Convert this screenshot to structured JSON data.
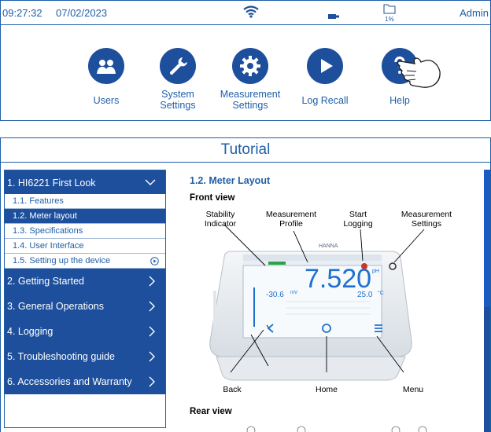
{
  "statusbar": {
    "time": "09:27:32",
    "date": "07/02/2023",
    "storage_percent": "1%",
    "user": "Admin"
  },
  "home_menu": [
    {
      "id": "users",
      "label": "Users",
      "icon": "users-icon"
    },
    {
      "id": "system-settings",
      "label": "System Settings",
      "icon": "wrench-icon"
    },
    {
      "id": "measurement-settings",
      "label": "Measurement Settings",
      "icon": "gear-icon"
    },
    {
      "id": "log-recall",
      "label": "Log Recall",
      "icon": "play-icon"
    },
    {
      "id": "help",
      "label": "Help",
      "icon": "question-icon"
    }
  ],
  "tutorial": {
    "title": "Tutorial",
    "sections": [
      {
        "label": "1. HI6221 First Look",
        "expanded": true
      },
      {
        "label": "2. Getting Started"
      },
      {
        "label": "3. General Operations"
      },
      {
        "label": "4. Logging"
      },
      {
        "label": "5. Troubleshooting guide"
      },
      {
        "label": "6. Accessories and Warranty"
      }
    ],
    "subsections": [
      {
        "label": "1.1. Features"
      },
      {
        "label": "1.2. Meter layout",
        "active": true
      },
      {
        "label": "1.3. Specifications"
      },
      {
        "label": "1.4. User Interface"
      },
      {
        "label": "1.5. Setting up the device"
      }
    ],
    "content": {
      "heading": "1.2.  Meter Layout",
      "front_view": "Front view",
      "rear_view": "Rear view",
      "callouts": {
        "stability": "Stability Indicator",
        "profile": "Measurement Profile",
        "logging": "Start Logging",
        "settings": "Measurement Settings",
        "back": "Back",
        "home": "Home",
        "menu": "Menu"
      },
      "device": {
        "brand": "HANNA",
        "reading": "7.520",
        "reading_unit": "pH",
        "temp_mv": "-30.6",
        "temp_mv_unit": "mV",
        "temperature": "25.0",
        "temperature_unit": "°C"
      }
    }
  },
  "colors": {
    "primary": "#1d4f9c",
    "text_blue": "#1f5fa8",
    "accent_blue": "#1f6fd0"
  }
}
